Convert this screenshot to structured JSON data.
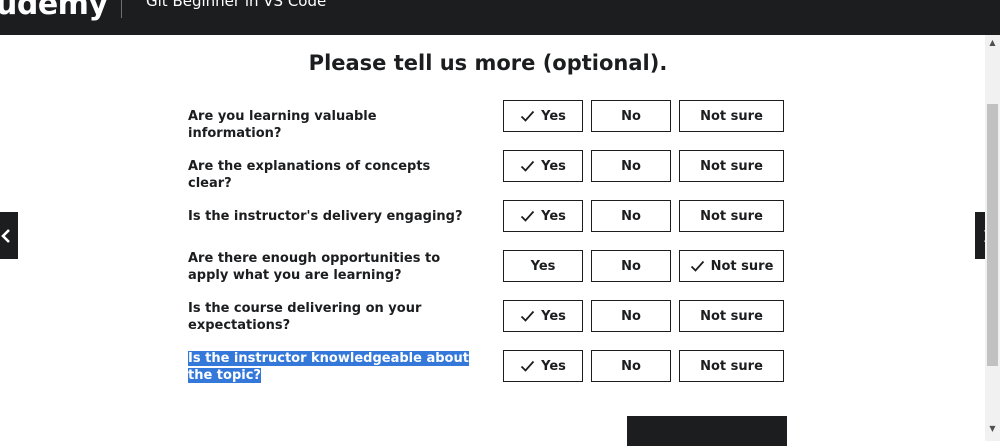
{
  "header": {
    "logo": "udemy",
    "course_title": "Git Beginner in VS Code"
  },
  "survey": {
    "heading": "Please tell us more (optional).",
    "option_labels": {
      "yes": "Yes",
      "no": "No",
      "not_sure": "Not sure"
    },
    "questions": [
      {
        "text": "Are you learning valuable information?",
        "selected": "yes"
      },
      {
        "text": "Are the explanations of concepts clear?",
        "selected": "yes"
      },
      {
        "text": "Is the instructor's delivery engaging?",
        "selected": "yes"
      },
      {
        "text": "Are there enough opportunities to apply what you are learning?",
        "selected": "not_sure"
      },
      {
        "text": "Is the course delivering on your expectations?",
        "selected": "yes"
      },
      {
        "text": "Is the instructor knowledgeable about the topic?",
        "selected": "yes",
        "text_highlighted": true
      }
    ]
  },
  "icons": {
    "nav_prev": "chevron-left-icon",
    "nav_next": "chevron-right-icon",
    "selected": "checkmark-icon"
  },
  "colors": {
    "header_bg": "#1c1d1f",
    "text": "#1c1d1f",
    "selection_highlight": "#3478d9"
  }
}
